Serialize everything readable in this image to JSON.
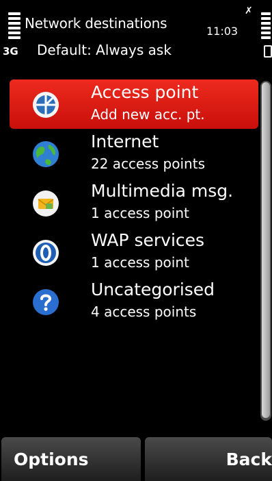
{
  "header": {
    "title": "Network destinations",
    "time": "11:03",
    "network_type": "3G",
    "default_line": "Default: Always ask",
    "icons": [
      "signal-strength-icon",
      "alert-icon",
      "battery-level-icon",
      "lock-icon"
    ]
  },
  "list": {
    "items": [
      {
        "name": "Access point",
        "sub": "Add new acc. pt.",
        "icon": "access-point-icon",
        "selected": true
      },
      {
        "name": "Internet",
        "sub": "22 access points",
        "icon": "globe-icon",
        "selected": false
      },
      {
        "name": "Multimedia msg.",
        "sub": "1 access point",
        "icon": "envelope-icon",
        "selected": false
      },
      {
        "name": "WAP services",
        "sub": "1 access point",
        "icon": "wap-icon",
        "selected": false
      },
      {
        "name": "Uncategorised",
        "sub": "4 access points",
        "icon": "question-icon",
        "selected": false
      }
    ]
  },
  "softkeys": {
    "left": "Options",
    "right": "Back"
  },
  "colors": {
    "selection": "#dd1e14",
    "background": "#000000",
    "softkey": "#333333"
  }
}
